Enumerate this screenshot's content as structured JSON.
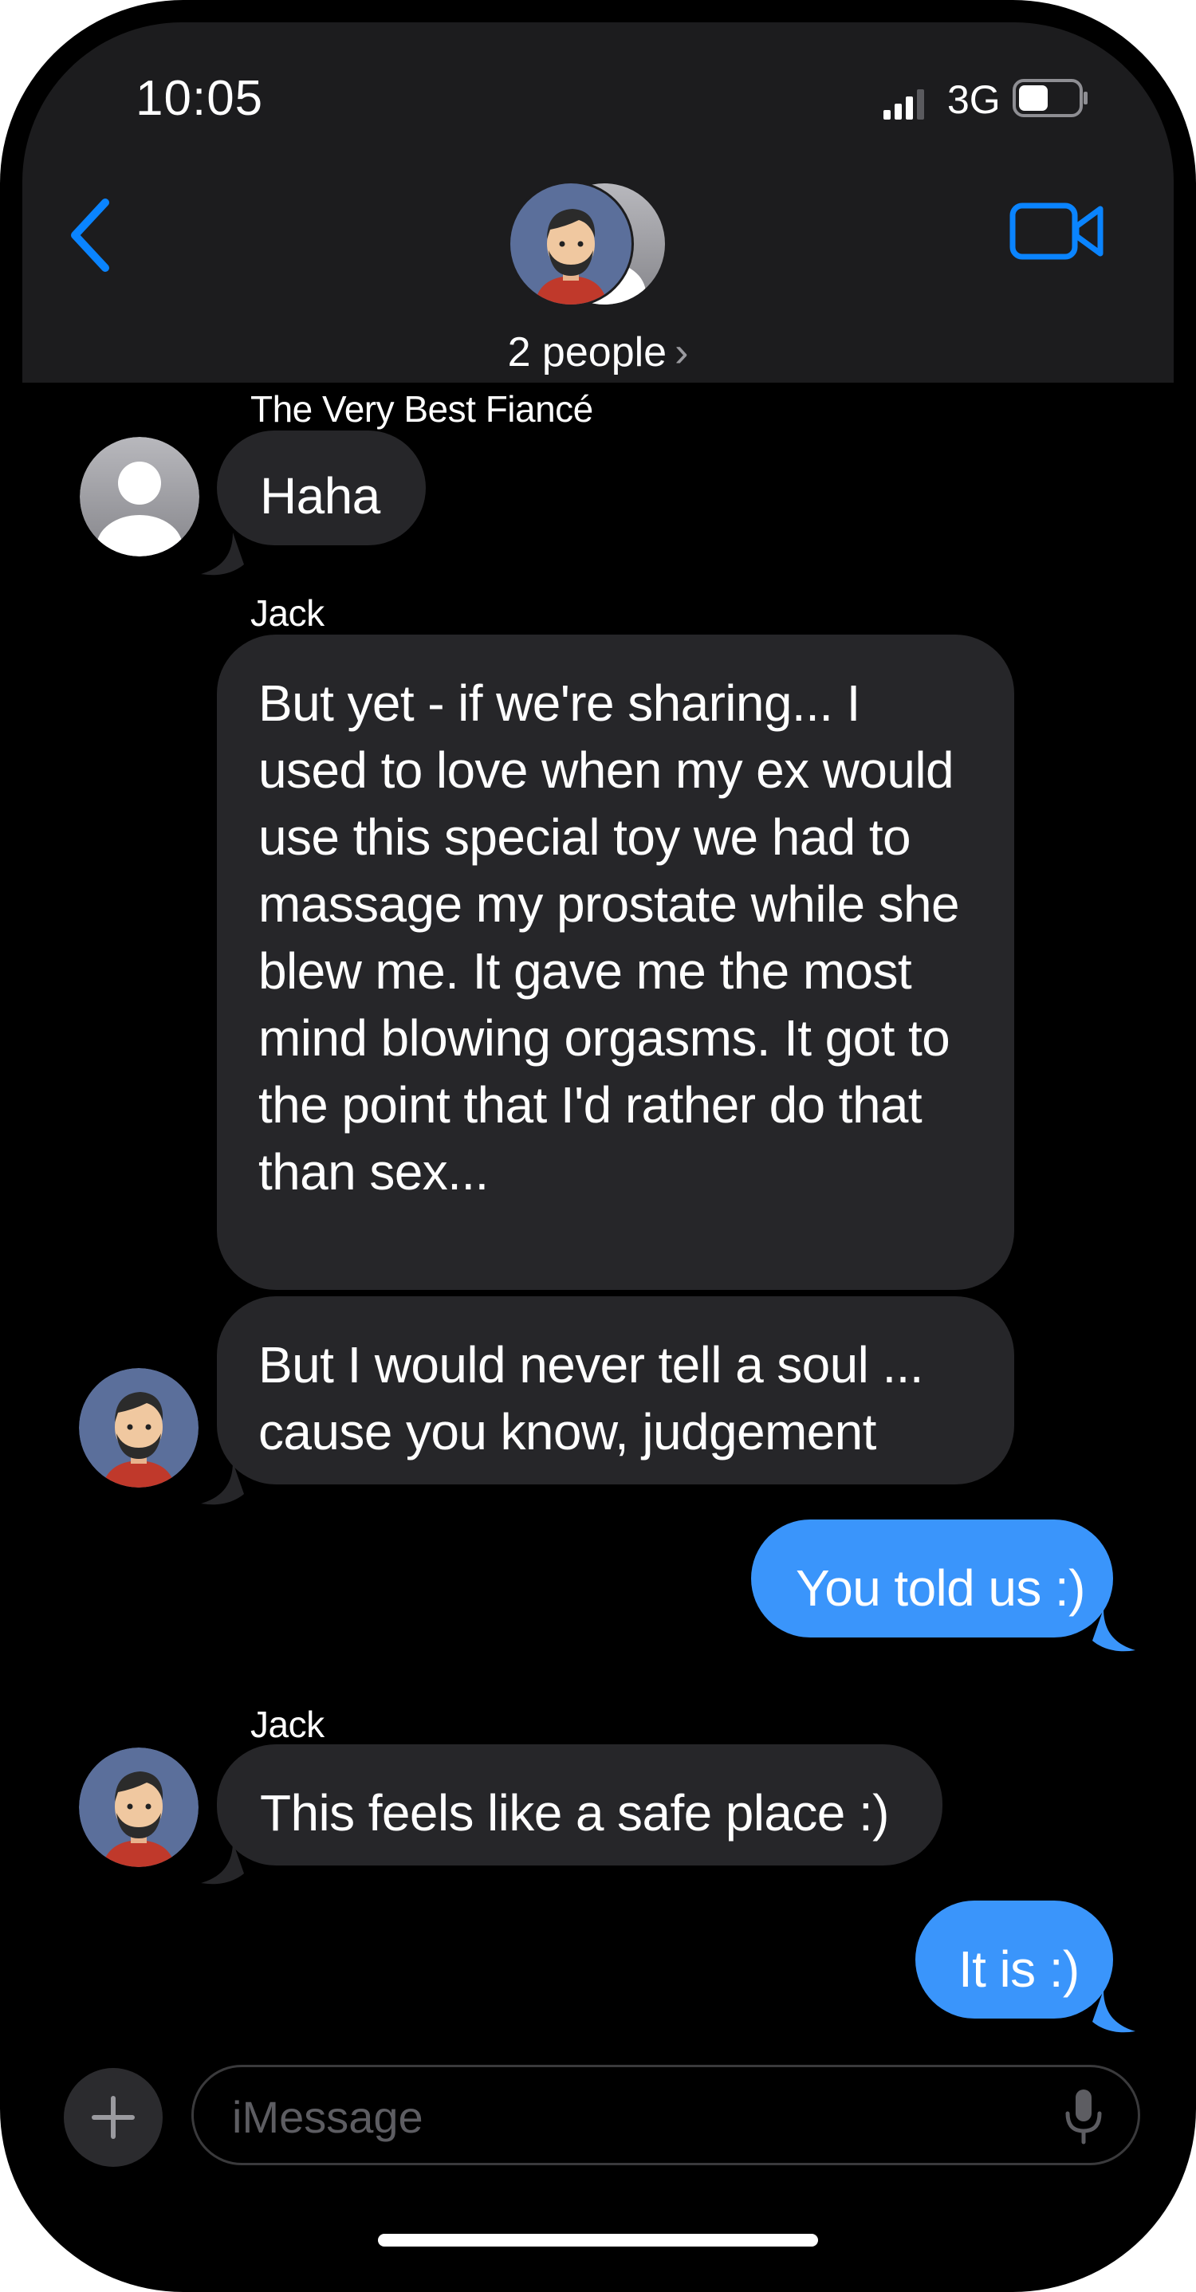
{
  "status_bar": {
    "time": "10:05",
    "network": "3G"
  },
  "header": {
    "people_label": "2 people",
    "chevron": "›"
  },
  "messages": [
    {
      "sender": "The Very Best Fiancé",
      "text": "Haha",
      "direction": "incoming"
    },
    {
      "sender": "Jack",
      "text": "But yet - if we're sharing... I used to love when my ex would use this special toy we had to massage my prostate while she blew me.  It gave me the most mind blowing orgasms.  It got to the point that I'd rather do that than sex...",
      "direction": "incoming"
    },
    {
      "sender": "",
      "text": "But I would never tell a soul ... cause you know, judgement",
      "direction": "incoming"
    },
    {
      "sender": "",
      "text": "You told us :)",
      "direction": "outgoing"
    },
    {
      "sender": "Jack",
      "text": "This feels like a safe place :)",
      "direction": "incoming"
    },
    {
      "sender": "",
      "text": "It is :)",
      "direction": "outgoing"
    }
  ],
  "input": {
    "placeholder": "iMessage"
  },
  "icons": {
    "back": "chevron-left-icon",
    "video": "video-camera-icon",
    "plus": "plus-icon",
    "mic": "microphone-icon"
  },
  "colors": {
    "accent": "#0a84ff",
    "outgoing_bubble": "#3a95fb",
    "incoming_bubble": "#262629",
    "header_bg": "#1c1c1e",
    "background": "#000000"
  }
}
